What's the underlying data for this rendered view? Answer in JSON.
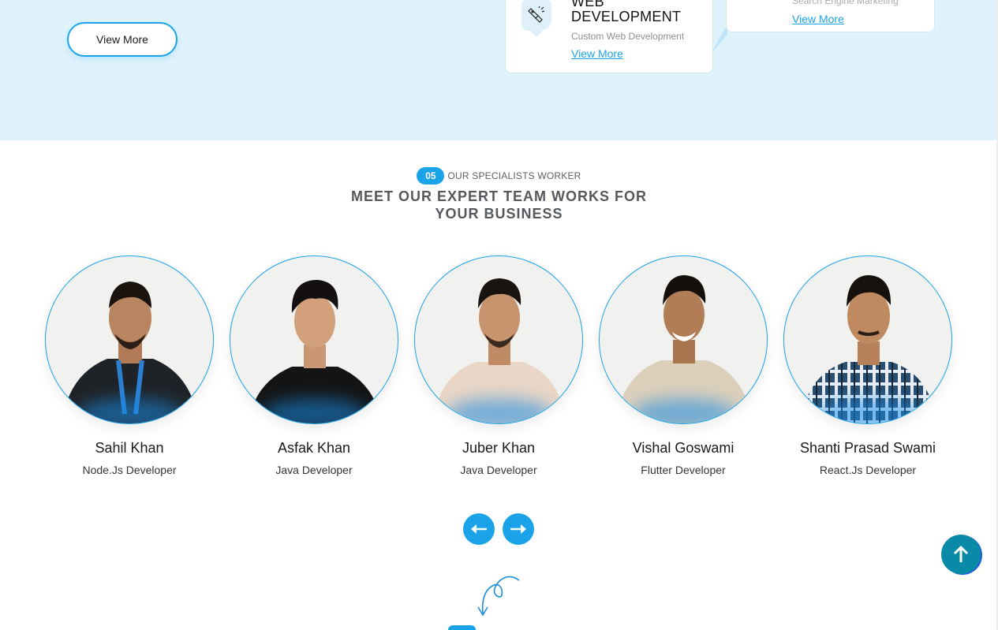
{
  "hero": {
    "view_more_label": "View More"
  },
  "services": {
    "web": {
      "icon": "brush-pen-icon",
      "title_line1": "WEB",
      "title_line2": "DEVELOPMENT",
      "subtitle": "Custom Web Development",
      "link": "View More"
    },
    "sem": {
      "subtitle": "Search Engine Marketing",
      "link": "View More"
    }
  },
  "team": {
    "badge": "05",
    "tagline": "OUR SPECIALISTS WORKER",
    "heading_line1": "MEET OUR EXPERT TEAM WORKS FOR",
    "heading_line2": "YOUR BUSINESS",
    "members": [
      {
        "name": "Sahil Khan",
        "role": "Node.Js Developer",
        "shirt": "#1f2226"
      },
      {
        "name": "Asfak Khan",
        "role": "Java Developer",
        "shirt": "#141414"
      },
      {
        "name": "Juber Khan",
        "role": "Java Developer",
        "shirt": "#ead6c6"
      },
      {
        "name": "Vishal Goswami",
        "role": "Flutter Developer",
        "shirt": "#ddd0bb"
      },
      {
        "name": "Shanti Prasad Swami",
        "role": "React.Js Developer",
        "shirt": "#2b4d6e"
      }
    ]
  },
  "nav": {
    "prev_icon": "arrow-left-icon",
    "next_icon": "arrow-right-icon",
    "scroll_top_icon": "arrow-up-icon"
  },
  "colors": {
    "accent": "#1aa3e8",
    "hero_bg": "#dff3fc",
    "scroll_top_bg": "#0a8aa6"
  }
}
